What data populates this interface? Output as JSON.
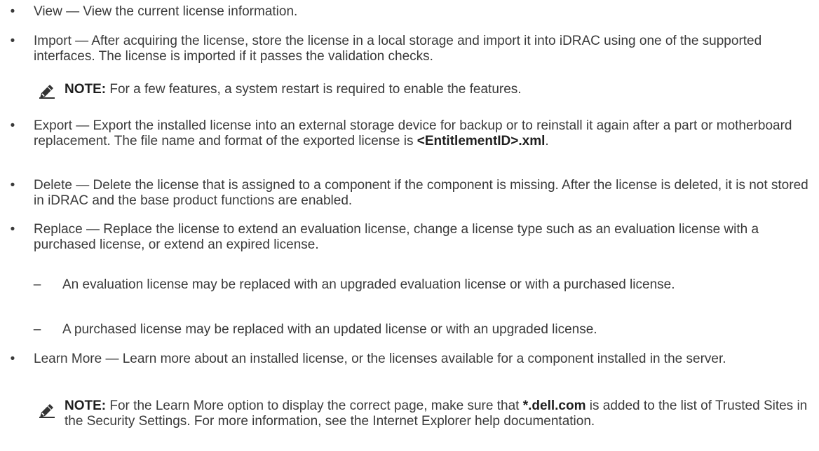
{
  "items": [
    {
      "label": "View",
      "dash": " — ",
      "text": "View the current license information."
    },
    {
      "label": "Import",
      "dash": " — ",
      "text": "After acquiring the license, store the license in a local storage and import it into iDRAC using one of the supported interfaces. The license is imported if it passes the validation checks."
    },
    {
      "label": "Export",
      "dash": " — ",
      "text": "Export the installed license into an external storage device for backup or to reinstall it again after a part or motherboard replacement. The file name and format of the exported license is ",
      "bold": "<EntitlementID>.xml",
      "tail": "."
    },
    {
      "label": "Delete",
      "dash": " — ",
      "text": "Delete the license that is assigned to a component if the component is missing. After the license is deleted, it is not stored in iDRAC and the base product functions are enabled."
    },
    {
      "label": "Replace",
      "dash": " — ",
      "text": "Replace the license to extend an evaluation license, change a license type such as an evaluation license with a purchased license, or extend an expired license."
    },
    {
      "label": "Learn More",
      "dash": " — ",
      "text": "Learn more about an installed license, or the licenses available for a component installed in the server."
    }
  ],
  "sub_items": [
    {
      "dash": "–",
      "text": "An evaluation license may be replaced with an upgraded evaluation license or with a purchased license."
    },
    {
      "dash": "–",
      "text": "A purchased license may be replaced with an updated license or with an upgraded license."
    }
  ],
  "notes": [
    {
      "label": "NOTE:",
      "text": " For a few features, a system restart is required to enable the features."
    },
    {
      "label": "NOTE:",
      "text_before": " For the Learn More option to display the correct page, make sure that ",
      "bold": "*.dell.com",
      "text_after": " is added to the list of Trusted Sites in the Security Settings. For more information, see the Internet Explorer help documentation."
    }
  ],
  "icons": {
    "note": "pencil-note-icon"
  },
  "colors": {
    "text": "#3a3a3a",
    "bold": "#1e1e1e",
    "icon": "#333333"
  }
}
